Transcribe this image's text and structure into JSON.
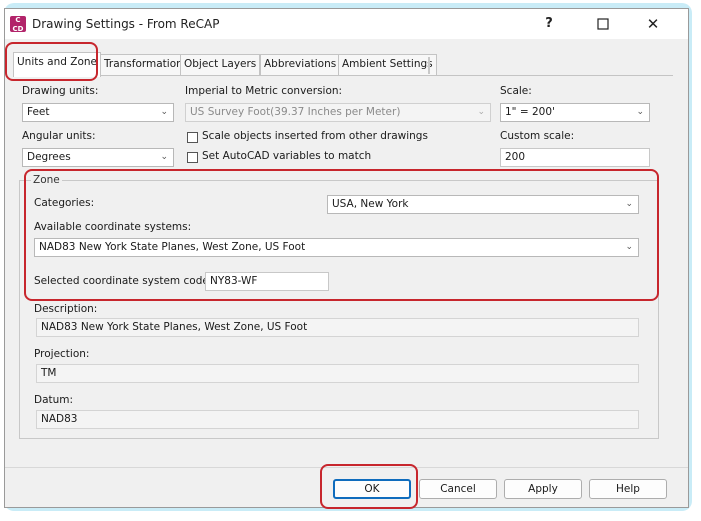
{
  "window": {
    "title": "Drawing Settings - From ReCAP",
    "app_icon_text": "C\nCD",
    "help_symbol": "?",
    "close_symbol": "✕"
  },
  "tabs": [
    {
      "label": "Units and Zone",
      "active": true
    },
    {
      "label": "Transformation",
      "active": false
    },
    {
      "label": "Object Layers",
      "active": false
    },
    {
      "label": "Abbreviations",
      "active": false
    },
    {
      "label": "Ambient Settings",
      "active": false
    }
  ],
  "units": {
    "drawing_units_label": "Drawing units:",
    "drawing_units_value": "Feet",
    "angular_units_label": "Angular units:",
    "angular_units_value": "Degrees",
    "imperial_label": "Imperial to Metric conversion:",
    "imperial_value": "US Survey Foot(39.37 Inches per Meter)",
    "scale_objects_label": "Scale objects inserted from other drawings",
    "set_autocad_label": "Set AutoCAD variables to match",
    "scale_label": "Scale:",
    "scale_value": "1\" = 200'",
    "custom_scale_label": "Custom scale:",
    "custom_scale_value": "200"
  },
  "zone": {
    "group_label": "Zone",
    "categories_label": "Categories:",
    "categories_value": "USA, New York",
    "available_label": "Available coordinate systems:",
    "available_value": "NAD83 New York State Planes, West Zone, US Foot",
    "code_label": "Selected coordinate system code:",
    "code_value": "NY83-WF",
    "description_label": "Description:",
    "description_value": "NAD83 New York State Planes, West Zone, US Foot",
    "projection_label": "Projection:",
    "projection_value": "TM",
    "datum_label": "Datum:",
    "datum_value": "NAD83"
  },
  "buttons": {
    "ok": "OK",
    "cancel": "Cancel",
    "apply": "Apply",
    "help": "Help"
  },
  "icons": {
    "dropdown": "chevron-down-icon",
    "minimize": "minimize-icon",
    "maximize": "maximize-icon"
  },
  "colors": {
    "highlight": "#c7262d",
    "default_button": "#0f6cbd",
    "app_icon": "#b2246a",
    "window_glow": "#c9ecf7"
  }
}
